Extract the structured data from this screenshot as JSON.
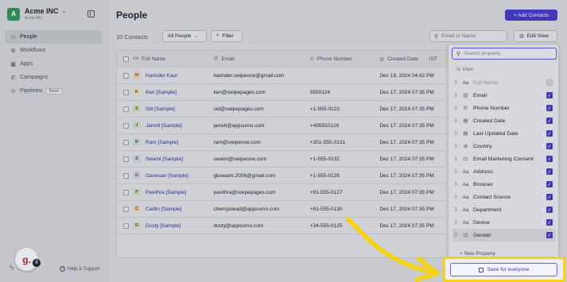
{
  "workspace": {
    "initial": "A",
    "name": "Acme INC",
    "subtitle": "Acme INC"
  },
  "nav": [
    {
      "label": "People",
      "icon": "people-icon",
      "glyph": "⚇"
    },
    {
      "label": "Workflows",
      "icon": "workflow-icon",
      "glyph": "⚙"
    },
    {
      "label": "Apps",
      "icon": "apps-icon",
      "glyph": "▦"
    },
    {
      "label": "Campaigns",
      "icon": "megaphone-icon",
      "glyph": "✆"
    },
    {
      "label": "Pipelines",
      "icon": "pipeline-icon",
      "glyph": "⊙",
      "badge": "Soon!"
    }
  ],
  "footer": {
    "help": "Help & Support",
    "chat_initial": "g.",
    "chat_count": "8"
  },
  "header": {
    "title": "People",
    "add_button": "+ Add Contacts"
  },
  "toolbar": {
    "count": "10 Contacts",
    "view_select": "All People",
    "filter": "Filter",
    "search_placeholder": "Email or Name",
    "edit_view": "Edit View"
  },
  "table": {
    "headers": {
      "name": "Full Name",
      "email": "Email",
      "phone": "Phone Number",
      "date": "Created Date",
      "date_tz": "IST"
    },
    "rows": [
      {
        "initial": "H",
        "name": "Harinder Kaur",
        "email": "harinder.swipeone@gmail.com",
        "phone": "",
        "date": "Dec 19, 2024 04:42 PM",
        "color": "#e8a96a"
      },
      {
        "initial": "K",
        "name": "Ken [Sample]",
        "email": "ken@swipepages.com",
        "phone": "5550124",
        "date": "Dec 17, 2024 07:35 PM",
        "color": "#e3cf6a"
      },
      {
        "initial": "S",
        "name": "Sid [Sample]",
        "email": "sid@swipepages.com",
        "phone": "+1-555-0123",
        "date": "Dec 17, 2024 07:35 PM",
        "color": "#9fcf7a"
      },
      {
        "initial": "J",
        "name": "Jarrett [Sample]",
        "email": "jarrett@appsumo.com",
        "phone": "+495550129",
        "date": "Dec 17, 2024 07:35 PM",
        "color": "#8fcf9a"
      },
      {
        "initial": "R",
        "name": "Ram [Sample]",
        "email": "ram@swipeone.com",
        "phone": "+351-555-0131",
        "date": "Dec 17, 2024 07:35 PM",
        "color": "#8fcfb8"
      },
      {
        "initial": "S",
        "name": "Swami [Sample]",
        "email": "swami@swipeone.com",
        "phone": "+1-555-0132",
        "date": "Dec 17, 2024 07:35 PM",
        "color": "#8fb8d8"
      },
      {
        "initial": "G",
        "name": "Ganesan [Sample]",
        "email": "gkswami.2006@gmail.com",
        "phone": "+1-555-0126",
        "date": "Dec 17, 2024 07:35 PM",
        "color": "#b0a8e0"
      },
      {
        "initial": "P",
        "name": "Pavithra [Sample]",
        "email": "pavithra@swipepages.com",
        "phone": "+91-555-0127",
        "date": "Dec 17, 2024 07:35 PM",
        "color": "#8fcf9a"
      },
      {
        "initial": "C",
        "name": "Caitlin [Sample]",
        "email": "chempstead@appsumo.com",
        "phone": "+61-555-0130",
        "date": "Dec 17, 2024 07:35 PM",
        "color": "#e8b86a"
      },
      {
        "initial": "D",
        "name": "Dusty [Sample]",
        "email": "dusty@appsumo.com",
        "phone": "+34-555-0125",
        "date": "Dec 17, 2024 07:35 PM",
        "color": "#a8cf7a"
      }
    ]
  },
  "panel": {
    "search_placeholder": "Search property",
    "section_label": "In View",
    "properties": [
      {
        "label": "Full Name",
        "icon": "text-icon",
        "glyph": "Aa",
        "checked": true,
        "disabled": true
      },
      {
        "label": "Email",
        "icon": "at-icon",
        "glyph": "@",
        "checked": true
      },
      {
        "label": "Phone Number",
        "icon": "phone-icon",
        "glyph": "✆",
        "checked": true
      },
      {
        "label": "Created Date",
        "icon": "calendar-icon",
        "glyph": "▤",
        "checked": true
      },
      {
        "label": "Last Updated Date",
        "icon": "calendar-icon",
        "glyph": "▤",
        "checked": true
      },
      {
        "label": "Country",
        "icon": "globe-icon",
        "glyph": "⊕",
        "checked": true
      },
      {
        "label": "Email Marketing Consent",
        "icon": "toggle-icon",
        "glyph": "⊡",
        "checked": true
      },
      {
        "label": "Address",
        "icon": "text-icon",
        "glyph": "Aa",
        "checked": true
      },
      {
        "label": "Browser",
        "icon": "text-icon",
        "glyph": "Aa",
        "checked": true
      },
      {
        "label": "Contact Source",
        "icon": "text-icon",
        "glyph": "Aa",
        "checked": true
      },
      {
        "label": "Department",
        "icon": "text-icon",
        "glyph": "Aa",
        "checked": true
      },
      {
        "label": "Device",
        "icon": "text-icon",
        "glyph": "Aa",
        "checked": true
      },
      {
        "label": "Gender",
        "icon": "toggle-icon",
        "glyph": "⊡",
        "checked": true
      }
    ],
    "new_property": "+ New Property",
    "save_button": "Save for everyone"
  }
}
